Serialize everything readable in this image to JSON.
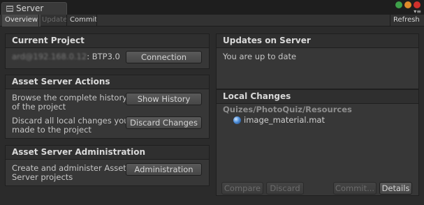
{
  "window": {
    "title": "Server"
  },
  "toolbar": {
    "overview": "Overview",
    "update": "Update",
    "commit": "Commit",
    "refresh": "Refresh"
  },
  "current_project": {
    "header": "Current Project",
    "user_host_redacted": "ard@192.168.0.12",
    "project_name": ": BTP3.0",
    "connection_label": "Connection"
  },
  "asset_server_actions": {
    "header": "Asset Server Actions",
    "history_text_line1": "Browse the complete history",
    "history_text_line2": "of the project",
    "show_history_label": "Show History",
    "discard_text_line1": "Discard all local changes you",
    "discard_text_line2": "made to the project",
    "discard_changes_label": "Discard Changes"
  },
  "asset_server_admin": {
    "header": "Asset Server Administration",
    "admin_text_line1": "Create and administer Asset",
    "admin_text_line2": "Server projects",
    "administration_label": "Administration"
  },
  "updates_on_server": {
    "header": "Updates on Server",
    "status": "You are up to date"
  },
  "local_changes": {
    "header": "Local Changes",
    "folder": "Quizes/PhotoQuiz/Resources",
    "items": [
      {
        "name": "image_material.mat",
        "icon": "material-sphere-icon"
      }
    ],
    "compare_label": "Compare",
    "discard_label": "Discard",
    "commit_label": "Commit...",
    "details_label": "Details"
  }
}
